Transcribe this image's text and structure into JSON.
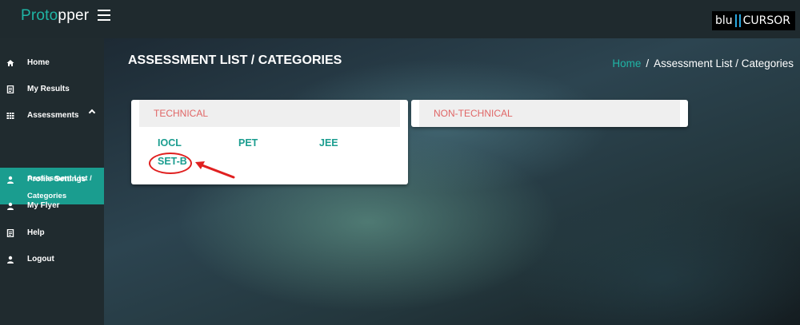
{
  "header": {
    "brand_prefix": "Proto",
    "brand_suffix": "pper",
    "logo_left": "blu",
    "logo_right": "CURSOR"
  },
  "sidebar": {
    "items": [
      {
        "label": "Home",
        "icon": "home-icon"
      },
      {
        "label": "My Results",
        "icon": "document-icon"
      },
      {
        "label": "Assessments",
        "icon": "grid-icon"
      },
      {
        "label": "Profile Settings",
        "icon": "user-icon"
      },
      {
        "label": "My Flyer",
        "icon": "user-icon"
      },
      {
        "label": "Help",
        "icon": "document-icon"
      },
      {
        "label": "Logout",
        "icon": "user-icon"
      }
    ],
    "active_sub": {
      "line1": "Assessment List /",
      "line2": "Categories"
    }
  },
  "main": {
    "title": "ASSESSMENT LIST / CATEGORIES",
    "breadcrumb": {
      "home": "Home",
      "separator": "/",
      "current": "Assessment List / Categories"
    },
    "cards": [
      {
        "title": "TECHNICAL",
        "links": [
          "IOCL",
          "PET",
          "JEE",
          "SET-B"
        ]
      },
      {
        "title": "NON-TECHNICAL",
        "links": []
      }
    ]
  },
  "colors": {
    "accent": "#1fb5a5",
    "active_bg": "#1a9d8f",
    "card_title": "#e06666",
    "annotation": "#e02020"
  }
}
